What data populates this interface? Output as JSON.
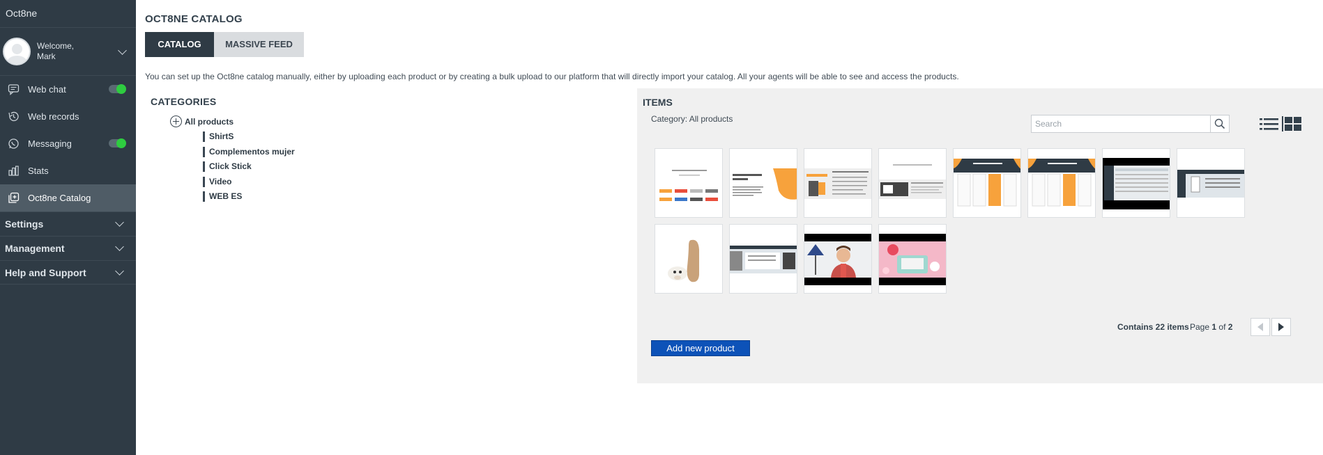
{
  "app": {
    "brand": "Oct8ne"
  },
  "user": {
    "welcome": "Welcome,",
    "name": "Mark"
  },
  "nav": [
    {
      "label": "Web chat",
      "icon": "chat-icon",
      "toggle": true
    },
    {
      "label": "Web records",
      "icon": "history-icon",
      "toggle": false
    },
    {
      "label": "Messaging",
      "icon": "whatsapp-icon",
      "toggle": true
    },
    {
      "label": "Stats",
      "icon": "bar-chart-icon",
      "toggle": false
    },
    {
      "label": "Oct8ne Catalog",
      "icon": "catalog-icon",
      "toggle": false,
      "active": true
    }
  ],
  "sections": [
    {
      "label": "Settings"
    },
    {
      "label": "Management"
    },
    {
      "label": "Help and Support"
    }
  ],
  "page": {
    "title": "OCT8NE CATALOG",
    "tabs": [
      {
        "label": "CATALOG",
        "active": true
      },
      {
        "label": "MASSIVE FEED",
        "active": false
      }
    ],
    "intro": "You can set up the Oct8ne catalog manually, either by uploading each product or by creating a bulk upload to our platform that will directly import your catalog. All your agents will be able to see and access the products."
  },
  "categories": {
    "title": "CATEGORIES",
    "root": "All products",
    "items": [
      "ShirtS",
      "Complementos mujer",
      "Click Stick",
      "Video",
      "WEB ES"
    ]
  },
  "items": {
    "title": "ITEMS",
    "category_line": "Category: All products",
    "search_placeholder": "Search",
    "thumbnails": [
      "grid-thumbnail-1",
      "grid-thumbnail-2",
      "grid-thumbnail-3",
      "grid-thumbnail-4",
      "grid-thumbnail-5",
      "grid-thumbnail-6",
      "grid-thumbnail-7",
      "grid-thumbnail-8",
      "grid-thumbnail-9",
      "grid-thumbnail-10",
      "grid-thumbnail-11",
      "grid-thumbnail-12"
    ],
    "contains": "Contains 22 items",
    "page_label": "Page",
    "page_current": "1",
    "page_of": "of",
    "page_total": "2",
    "add_button": "Add new product"
  },
  "colors": {
    "sidebar_bg": "#2f3b45",
    "toggle_on": "#2ecc40",
    "primary_button": "#0d52b8",
    "panel_bg": "#f0f0f0",
    "accent_orange": "#f7a23c"
  }
}
